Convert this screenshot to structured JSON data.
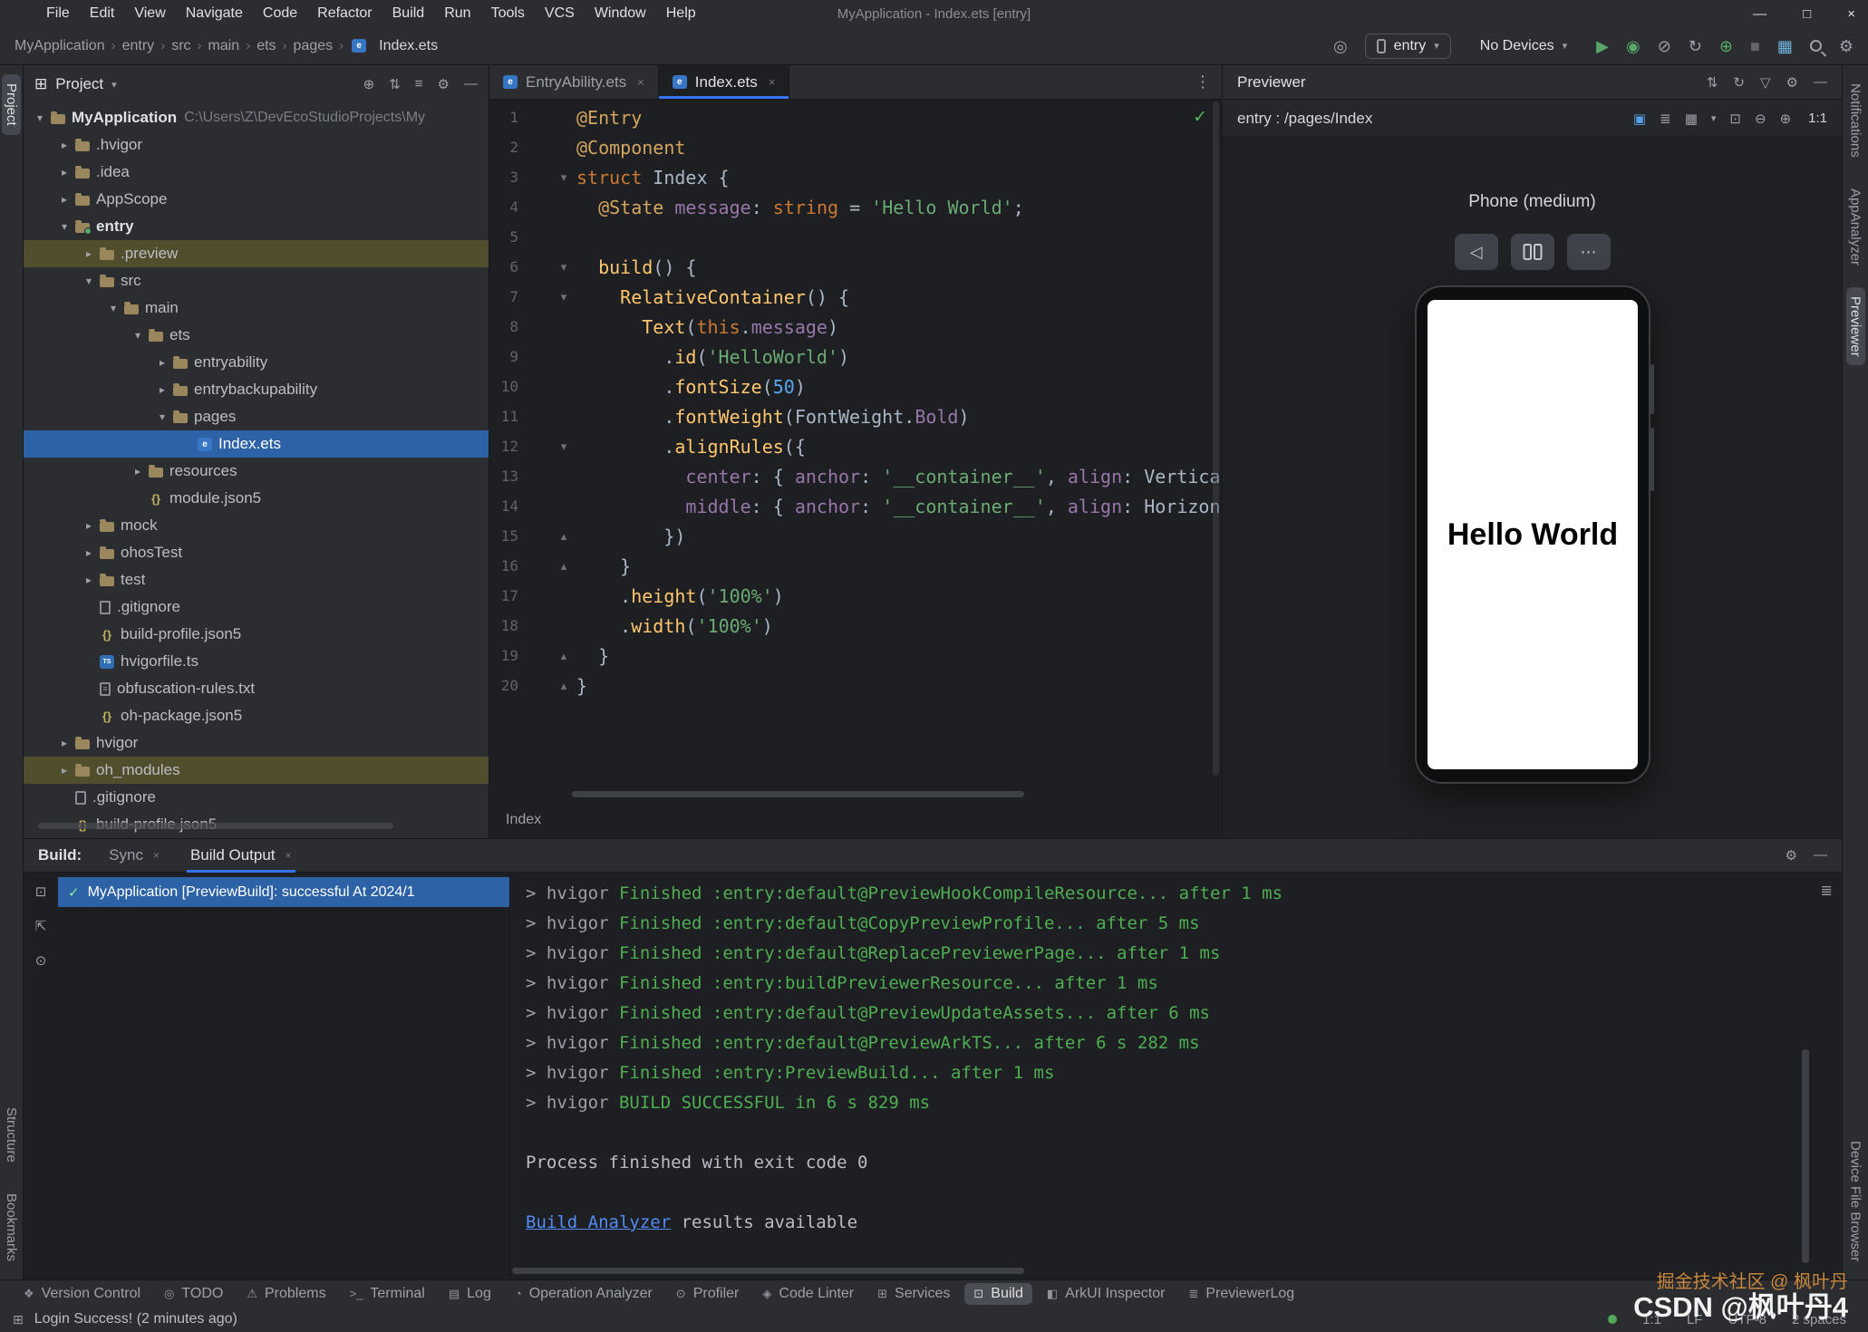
{
  "icons": {
    "min": "—",
    "max": "□",
    "close": "×",
    "chevron_down": "▾",
    "chevron_right": "›",
    "more_vert": "⋮",
    "more_horiz": "⋯",
    "target": "◎",
    "run": "▶",
    "debug": "◉",
    "coverage": "⊘",
    "restart": "↻",
    "attach": "⊕",
    "stop": "■",
    "layout": "▦",
    "settings": "⚙",
    "sort": "⇅",
    "refresh": "↻",
    "filter": "▽",
    "hide": "—",
    "locate": "⊕",
    "collapse": "⇅",
    "expand": "≡",
    "grid_small": "⊞",
    "inspect": "▣",
    "layers": "≣",
    "grid": "▦",
    "frame": "⊡",
    "zoom_out": "⊖",
    "zoom_in": "⊕",
    "back": "◁",
    "check": "✓",
    "wrap": "≣",
    "pin": "⊙",
    "export": "⇱",
    "box": "⊡"
  },
  "menu": {
    "items": [
      "File",
      "Edit",
      "View",
      "Navigate",
      "Code",
      "Refactor",
      "Build",
      "Run",
      "Tools",
      "VCS",
      "Window",
      "Help"
    ],
    "title": "MyApplication - Index.ets [entry]"
  },
  "toolbar": {
    "breadcrumbs": [
      "MyApplication",
      "entry",
      "src",
      "main",
      "ets",
      "pages"
    ],
    "file": "Index.ets",
    "run_config": "entry",
    "device": "No Devices"
  },
  "project_panel": {
    "title": "Project",
    "tree": [
      {
        "name": "MyApplication",
        "suffix": "C:\\Users\\Z\\DevEcoStudioProjects\\My",
        "level": 0,
        "icon": "folder",
        "chev": "open",
        "bold": true
      },
      {
        "name": ".hvigor",
        "level": 1,
        "icon": "folder",
        "chev": "closed"
      },
      {
        "name": ".idea",
        "level": 1,
        "icon": "folder",
        "chev": "closed"
      },
      {
        "name": "AppScope",
        "level": 1,
        "icon": "folder",
        "chev": "closed"
      },
      {
        "name": "entry",
        "level": 1,
        "icon": "module",
        "chev": "open",
        "bold": true
      },
      {
        "name": ".preview",
        "level": 2,
        "icon": "folder",
        "chev": "closed",
        "row": "olive"
      },
      {
        "name": "src",
        "level": 2,
        "icon": "folder",
        "chev": "open"
      },
      {
        "name": "main",
        "level": 3,
        "icon": "folder",
        "chev": "open"
      },
      {
        "name": "ets",
        "level": 4,
        "icon": "folder",
        "chev": "open"
      },
      {
        "name": "entryability",
        "level": 5,
        "icon": "folder",
        "chev": "closed"
      },
      {
        "name": "entrybackupability",
        "level": 5,
        "icon": "folder",
        "chev": "closed"
      },
      {
        "name": "pages",
        "level": 5,
        "icon": "folder",
        "chev": "open"
      },
      {
        "name": "Index.ets",
        "level": 6,
        "icon": "ets",
        "row": "selected"
      },
      {
        "name": "resources",
        "level": 4,
        "icon": "folder",
        "chev": "closed"
      },
      {
        "name": "module.json5",
        "level": 4,
        "icon": "json"
      },
      {
        "name": "mock",
        "level": 2,
        "icon": "folder",
        "chev": "closed"
      },
      {
        "name": "ohosTest",
        "level": 2,
        "icon": "folder",
        "chev": "closed"
      },
      {
        "name": "test",
        "level": 2,
        "icon": "folder",
        "chev": "closed"
      },
      {
        "name": ".gitignore",
        "level": 2,
        "icon": "git"
      },
      {
        "name": "build-profile.json5",
        "level": 2,
        "icon": "json"
      },
      {
        "name": "hvigorfile.ts",
        "level": 2,
        "icon": "ts"
      },
      {
        "name": "obfuscation-rules.txt",
        "level": 2,
        "icon": "txt"
      },
      {
        "name": "oh-package.json5",
        "level": 2,
        "icon": "json"
      },
      {
        "name": "hvigor",
        "level": 1,
        "icon": "folder",
        "chev": "closed"
      },
      {
        "name": "oh_modules",
        "level": 1,
        "icon": "folder",
        "chev": "closed",
        "row": "olive"
      },
      {
        "name": ".gitignore",
        "level": 1,
        "icon": "git"
      },
      {
        "name": "build-profile.json5",
        "level": 1,
        "icon": "json"
      }
    ]
  },
  "editor": {
    "tabs": [
      {
        "label": "EntryAbility.ets",
        "active": false
      },
      {
        "label": "Index.ets",
        "active": true
      }
    ],
    "breadcrumb": "Index",
    "lines": [
      {
        "n": 1,
        "seg": [
          [
            "dec",
            "@Entry"
          ]
        ]
      },
      {
        "n": 2,
        "seg": [
          [
            "dec",
            "@Component"
          ]
        ]
      },
      {
        "n": 3,
        "fold": "open",
        "seg": [
          [
            "k",
            "struct "
          ],
          [
            "pl",
            "Index "
          ],
          [
            "pl",
            "{"
          ]
        ]
      },
      {
        "n": 4,
        "seg": [
          [
            "pl",
            "  "
          ],
          [
            "dec",
            "@State"
          ],
          [
            "pl",
            " "
          ],
          [
            "prop",
            "message"
          ],
          [
            "pl",
            ": "
          ],
          [
            "k",
            "string"
          ],
          [
            "pl",
            " = "
          ],
          [
            "str",
            "'Hello World'"
          ],
          [
            "pl",
            ";"
          ]
        ]
      },
      {
        "n": 5,
        "seg": []
      },
      {
        "n": 6,
        "fold": "open",
        "seg": [
          [
            "pl",
            "  "
          ],
          [
            "fn",
            "build"
          ],
          [
            "pl",
            "() {"
          ]
        ]
      },
      {
        "n": 7,
        "fold": "open",
        "seg": [
          [
            "pl",
            "    "
          ],
          [
            "fn",
            "RelativeContainer"
          ],
          [
            "pl",
            "() {"
          ]
        ]
      },
      {
        "n": 8,
        "seg": [
          [
            "pl",
            "      "
          ],
          [
            "fn",
            "Text"
          ],
          [
            "pl",
            "("
          ],
          [
            "k",
            "this"
          ],
          [
            "pl",
            "."
          ],
          [
            "prop",
            "message"
          ],
          [
            "pl",
            ")"
          ]
        ]
      },
      {
        "n": 9,
        "seg": [
          [
            "pl",
            "        ."
          ],
          [
            "fn",
            "id"
          ],
          [
            "pl",
            "("
          ],
          [
            "str",
            "'HelloWorld'"
          ],
          [
            "pl",
            ")"
          ]
        ]
      },
      {
        "n": 10,
        "seg": [
          [
            "pl",
            "        ."
          ],
          [
            "fn",
            "fontSize"
          ],
          [
            "pl",
            "("
          ],
          [
            "num",
            "50"
          ],
          [
            "pl",
            ")"
          ]
        ]
      },
      {
        "n": 11,
        "seg": [
          [
            "pl",
            "        ."
          ],
          [
            "fn",
            "fontWeight"
          ],
          [
            "pl",
            "("
          ],
          [
            "pl",
            "FontWeight"
          ],
          [
            "pl",
            "."
          ],
          [
            "prop",
            "Bold"
          ],
          [
            "pl",
            ")"
          ]
        ]
      },
      {
        "n": 12,
        "fold": "open",
        "seg": [
          [
            "pl",
            "        ."
          ],
          [
            "fn",
            "alignRules"
          ],
          [
            "pl",
            "({"
          ]
        ]
      },
      {
        "n": 13,
        "seg": [
          [
            "pl",
            "          "
          ],
          [
            "prop",
            "center"
          ],
          [
            "pl",
            ": { "
          ],
          [
            "prop",
            "anchor"
          ],
          [
            "pl",
            ": "
          ],
          [
            "str",
            "'__container__'"
          ],
          [
            "pl",
            ", "
          ],
          [
            "prop",
            "align"
          ],
          [
            "pl",
            ": "
          ],
          [
            "pl",
            "Vertica"
          ]
        ]
      },
      {
        "n": 14,
        "seg": [
          [
            "pl",
            "          "
          ],
          [
            "prop",
            "middle"
          ],
          [
            "pl",
            ": { "
          ],
          [
            "prop",
            "anchor"
          ],
          [
            "pl",
            ": "
          ],
          [
            "str",
            "'__container__'"
          ],
          [
            "pl",
            ", "
          ],
          [
            "prop",
            "align"
          ],
          [
            "pl",
            ": "
          ],
          [
            "pl",
            "Horizon"
          ]
        ]
      },
      {
        "n": 15,
        "fold": "close",
        "seg": [
          [
            "pl",
            "        })"
          ]
        ]
      },
      {
        "n": 16,
        "fold": "close",
        "seg": [
          [
            "pl",
            "    }"
          ]
        ]
      },
      {
        "n": 17,
        "seg": [
          [
            "pl",
            "    ."
          ],
          [
            "fn",
            "height"
          ],
          [
            "pl",
            "("
          ],
          [
            "str",
            "'100%'"
          ],
          [
            "pl",
            ")"
          ]
        ]
      },
      {
        "n": 18,
        "seg": [
          [
            "pl",
            "    ."
          ],
          [
            "fn",
            "width"
          ],
          [
            "pl",
            "("
          ],
          [
            "str",
            "'100%'"
          ],
          [
            "pl",
            ")"
          ]
        ]
      },
      {
        "n": 19,
        "fold": "close",
        "seg": [
          [
            "pl",
            "  }"
          ]
        ]
      },
      {
        "n": 20,
        "fold": "close",
        "seg": [
          [
            "pl",
            "}"
          ]
        ]
      }
    ]
  },
  "previewer": {
    "title": "Previewer",
    "target": "entry : /pages/Index",
    "device_label": "Phone (medium)",
    "screen_text": "Hello World",
    "zoom_ratio": "1:1"
  },
  "left_strip": [
    {
      "label": "Project",
      "active": true
    },
    {
      "label": "Structure",
      "spacer": true
    },
    {
      "label": "Bookmarks"
    }
  ],
  "right_strip": [
    {
      "label": "Notifications"
    },
    {
      "label": "AppAnalyzer"
    },
    {
      "label": "Previewer",
      "active": true
    },
    {
      "label": "Device File Browser",
      "spacer": true
    }
  ],
  "build_panel": {
    "label": "Build:",
    "tabs": [
      {
        "label": "Sync"
      },
      {
        "label": "Build Output",
        "active": true
      }
    ],
    "result": "MyApplication [PreviewBuild]: successful At 2024/1",
    "console": [
      {
        "pre": "> hvigor ",
        "text": "Finished :entry:default@PreviewHookCompileResource... after 1 ms"
      },
      {
        "pre": "> hvigor ",
        "text": "Finished :entry:default@CopyPreviewProfile... after 5 ms"
      },
      {
        "pre": "> hvigor ",
        "text": "Finished :entry:default@ReplacePreviewerPage... after 1 ms"
      },
      {
        "pre": "> hvigor ",
        "text": "Finished :entry:buildPreviewerResource... after 1 ms"
      },
      {
        "pre": "> hvigor ",
        "text": "Finished :entry:default@PreviewUpdateAssets... after 6 ms"
      },
      {
        "pre": "> hvigor ",
        "text": "Finished :entry:default@PreviewArkTS... after 6 s 282 ms"
      },
      {
        "pre": "> hvigor ",
        "text": "Finished :entry:PreviewBuild... after 1 ms"
      },
      {
        "pre": "> hvigor ",
        "text": "BUILD SUCCESSFUL in 6 s 829 ms"
      },
      {
        "blank": true
      },
      {
        "plain": "Process finished with exit code 0"
      },
      {
        "blank": true
      },
      {
        "link": "Build Analyzer",
        "plain": " results available"
      }
    ]
  },
  "status_toolbar": [
    {
      "label": "Version Control",
      "glyph": "❖"
    },
    {
      "label": "TODO",
      "glyph": "◎"
    },
    {
      "label": "Problems",
      "glyph": "⚠"
    },
    {
      "label": "Terminal",
      "glyph": ">_"
    },
    {
      "label": "Log",
      "glyph": "▤"
    },
    {
      "label": "Operation Analyzer",
      "glyph": "◔"
    },
    {
      "label": "Profiler",
      "glyph": "⊙"
    },
    {
      "label": "Code Linter",
      "glyph": "◈"
    },
    {
      "label": "Services",
      "glyph": "⊞"
    },
    {
      "label": "Build",
      "glyph": "⊡",
      "active": true
    },
    {
      "label": "ArkUI Inspector",
      "glyph": "◧"
    },
    {
      "label": "PreviewerLog",
      "glyph": "≣"
    }
  ],
  "status_bar": {
    "message": "Login Success! (2 minutes ago)",
    "right": [
      "1:1",
      "LF",
      "UTF-8",
      "2 spaces"
    ]
  },
  "watermark": {
    "line1": "掘金技术社区 @ 枫叶丹",
    "line2": "CSDN @枫叶丹4"
  }
}
